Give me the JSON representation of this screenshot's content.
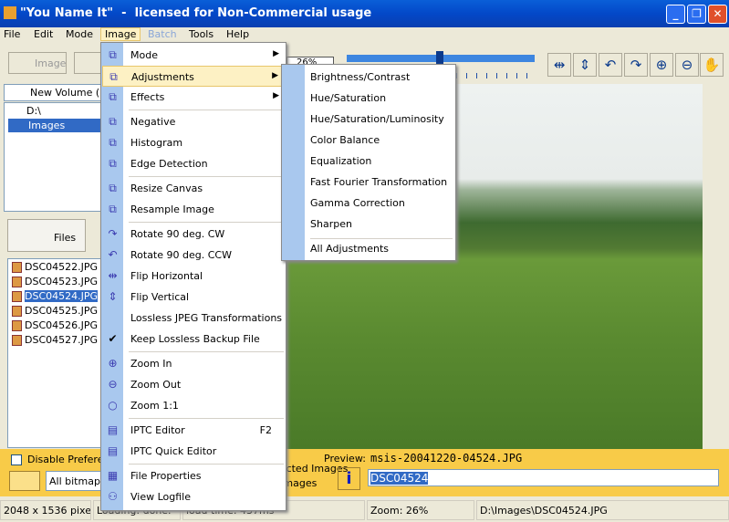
{
  "window": {
    "title": "\"You Name It\"  -  licensed for Non-Commercial usage",
    "minimize": "_",
    "maximize": "❐",
    "close": "✕"
  },
  "menubar": [
    "File",
    "Edit",
    "Mode",
    "Image",
    "Batch",
    "Tools",
    "Help"
  ],
  "toolbar": {
    "image_button": "Image",
    "zoom_value": "26%",
    "tools": [
      "flip-horizontal-icon",
      "flip-vertical-icon",
      "rotate-ccw-icon",
      "rotate-cw-icon",
      "zoom-in-icon",
      "zoom-out-icon",
      "hand-icon"
    ]
  },
  "left": {
    "drive": "New Volume (D:)",
    "tree": [
      "D:\\",
      "Images"
    ],
    "files_tab": "Files",
    "files": [
      "DSC04522.JPG",
      "DSC04523.JPG",
      "DSC04524.JPG",
      "DSC04525.JPG",
      "DSC04526.JPG",
      "DSC04527.JPG"
    ],
    "selected_file": "DSC04524.JPG"
  },
  "image_menu": [
    {
      "label": "Mode",
      "submenu": true
    },
    {
      "label": "Adjustments",
      "submenu": true,
      "selected": true
    },
    {
      "label": "Effects",
      "submenu": true
    },
    {
      "sep": true
    },
    {
      "label": "Negative"
    },
    {
      "label": "Histogram"
    },
    {
      "label": "Edge Detection"
    },
    {
      "sep": true
    },
    {
      "label": "Resize Canvas"
    },
    {
      "label": "Resample Image"
    },
    {
      "sep": true
    },
    {
      "label": "Rotate 90 deg. CW"
    },
    {
      "label": "Rotate 90 deg. CCW"
    },
    {
      "label": "Flip Horizontal"
    },
    {
      "label": "Flip Vertical"
    },
    {
      "label": "Lossless JPEG Transformations"
    },
    {
      "label": "Keep Lossless Backup File",
      "checked": true
    },
    {
      "sep": true
    },
    {
      "label": "Zoom In"
    },
    {
      "label": "Zoom Out"
    },
    {
      "label": "Zoom 1:1"
    },
    {
      "sep": true
    },
    {
      "label": "IPTC Editor",
      "shortcut": "F2"
    },
    {
      "label": "IPTC Quick Editor"
    },
    {
      "sep": true
    },
    {
      "label": "File Properties"
    },
    {
      "label": "View Logfile"
    }
  ],
  "adjustments_menu": [
    "Brightness/Contrast",
    "Hue/Saturation",
    "Hue/Saturation/Luminosity",
    "Color Balance",
    "Equalization",
    "Fast Fourier Transformation",
    "Gamma Correction",
    "Sharpen",
    "All Adjustments"
  ],
  "bottom": {
    "disable_prefs": "Disable Preferences",
    "filter": "All bitmap files",
    "radio1": "Selected Images",
    "radio2": "All Images",
    "preview_label": "Preview:",
    "preview_name": "msis-20041220-04524.JPG",
    "name_field": "DSC04524"
  },
  "status": [
    "2048 x 1536 pixels",
    "Loading: done.",
    "load time: 437ms",
    "Zoom: 26%",
    "D:\\Images\\DSC04524.JPG"
  ]
}
